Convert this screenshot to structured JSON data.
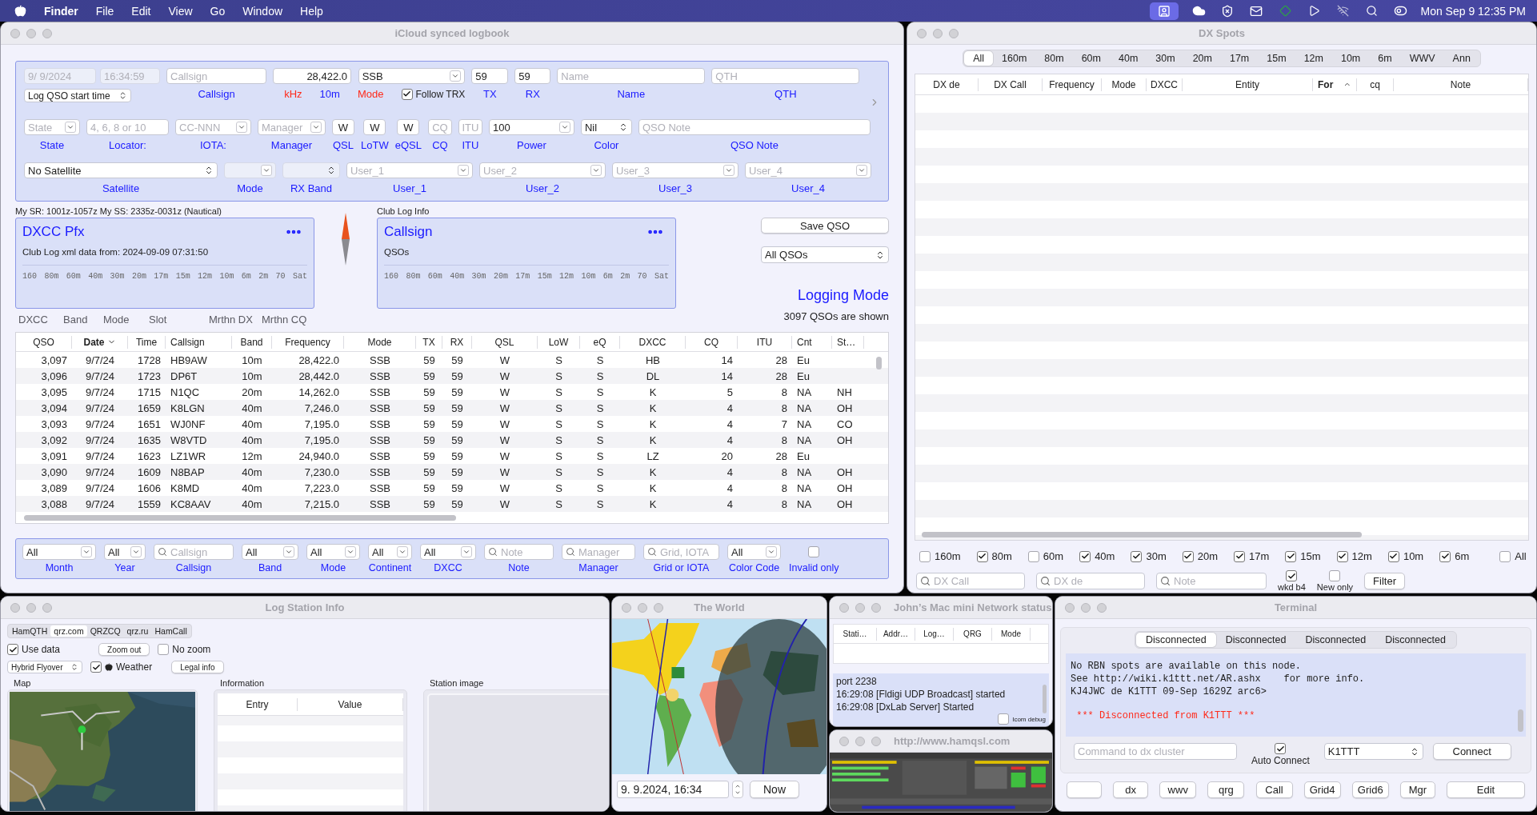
{
  "menu_bar": {
    "app": "Finder",
    "menus": [
      "File",
      "Edit",
      "View",
      "Go",
      "Window",
      "Help"
    ],
    "status_items": [
      {
        "kind": "screen",
        "selected": true
      },
      {
        "kind": "cloud",
        "selected": false
      },
      {
        "kind": "shield",
        "selected": false
      },
      {
        "kind": "mail",
        "selected": false
      },
      {
        "kind": "diamond",
        "selected": false
      },
      {
        "kind": "play",
        "selected": false
      },
      {
        "kind": "wifi",
        "selected": false
      },
      {
        "kind": "search",
        "selected": false
      },
      {
        "kind": "toggle",
        "selected": false
      }
    ],
    "clock": "Mon Sep 9  12:35 PM"
  },
  "logbook": {
    "title": "iCloud synced logbook",
    "form": {
      "start": {
        "date": "9/ 9/2024",
        "time": "16:34:59",
        "disabled": true,
        "time_mode": "Log QSO start time"
      },
      "lines": [
        {
          "fields": [
            {
              "kind": "text",
              "placeholder": "Callsign",
              "labels": [
                {
                  "text": "Callsign",
                  "alert": false
                }
              ]
            },
            {
              "kind": "number",
              "value": "28,422.0",
              "labels": [
                {
                  "text": "kHz",
                  "alert": true
                },
                {
                  "text": "10m",
                  "alert": false
                }
              ]
            },
            {
              "kind": "select",
              "value": "SSB",
              "labels": [
                {
                  "text": "Mode",
                  "alert": true
                }
              ],
              "checkbox": {
                "label": "Follow TRX",
                "checked": true
              }
            },
            {
              "kind": "text",
              "value": "59",
              "labels": [
                {
                  "text": "TX",
                  "alert": false
                }
              ]
            },
            {
              "kind": "text",
              "value": "59",
              "labels": [
                {
                  "text": "RX",
                  "alert": false
                }
              ]
            },
            {
              "kind": "text",
              "placeholder": "Name",
              "labels": [
                {
                  "text": "Name",
                  "alert": false
                }
              ]
            },
            {
              "kind": "text",
              "placeholder": "QTH",
              "labels": [
                {
                  "text": "QTH",
                  "alert": false
                }
              ]
            }
          ]
        },
        {
          "fields": [
            {
              "kind": "select",
              "placeholder": "State",
              "labels": [
                {
                  "text": "State",
                  "alert": false
                }
              ]
            },
            {
              "kind": "text",
              "placeholder": "4, 6, 8 or 10",
              "labels": [
                {
                  "text": "Locator:",
                  "alert": false
                }
              ]
            },
            {
              "kind": "select",
              "placeholder": "CC-NNN",
              "labels": [
                {
                  "text": "IOTA:",
                  "alert": false
                }
              ]
            },
            {
              "kind": "select",
              "placeholder": "Manager",
              "labels": [
                {
                  "text": "Manager",
                  "alert": false
                }
              ]
            },
            {
              "kind": "short",
              "value": "W",
              "labels": [
                {
                  "text": "QSL",
                  "alert": false
                }
              ]
            },
            {
              "kind": "short",
              "value": "W",
              "labels": [
                {
                  "text": "LoTW",
                  "alert": false
                }
              ]
            },
            {
              "kind": "short",
              "value": "W",
              "labels": [
                {
                  "text": "eQSL",
                  "alert": false
                }
              ]
            },
            {
              "kind": "short",
              "placeholder": "CQ",
              "labels": [
                {
                  "text": "CQ",
                  "alert": false
                }
              ]
            },
            {
              "kind": "short",
              "placeholder": "ITU",
              "labels": [
                {
                  "text": "ITU",
                  "alert": false
                }
              ]
            },
            {
              "kind": "select",
              "value": "100",
              "labels": [
                {
                  "text": "Power",
                  "alert": false
                }
              ]
            },
            {
              "kind": "popup",
              "value": "Nil",
              "labels": [
                {
                  "text": "Color",
                  "alert": false
                }
              ]
            },
            {
              "kind": "text",
              "placeholder": "QSO Note",
              "labels": [
                {
                  "text": "QSO Note",
                  "alert": false
                }
              ]
            }
          ]
        },
        {
          "fields": [
            {
              "kind": "popup",
              "value": "No Satellite",
              "disabled": false,
              "labels": [
                {
                  "text": "Satellite",
                  "alert": false
                }
              ]
            },
            {
              "kind": "select",
              "disabled": true,
              "labels": [
                {
                  "text": "Mode",
                  "alert": false
                }
              ]
            },
            {
              "kind": "popup",
              "disabled": true,
              "labels": [
                {
                  "text": "RX Band",
                  "alert": false
                }
              ]
            },
            {
              "kind": "select",
              "placeholder": "User_1",
              "disabled": false,
              "labels": [
                {
                  "text": "User_1",
                  "alert": false
                }
              ]
            },
            {
              "kind": "select",
              "placeholder": "User_2",
              "disabled": false,
              "labels": [
                {
                  "text": "User_2",
                  "alert": false
                }
              ]
            },
            {
              "kind": "select",
              "placeholder": "User_3",
              "disabled": false,
              "labels": [
                {
                  "text": "User_3",
                  "alert": false
                }
              ]
            },
            {
              "kind": "select",
              "placeholder": "User_4",
              "disabled": false,
              "labels": [
                {
                  "text": "User_4",
                  "alert": false
                }
              ]
            }
          ]
        }
      ]
    },
    "sun_times": "My SR: 1001z-1057z  My SS: 2335z-0031z (Nautical)",
    "dxcc_card": {
      "title": "DXCC Pfx",
      "text": "Club Log xml data from: 2024-09-09 07:31:50",
      "bands": [
        "160",
        "80m",
        "60m",
        "40m",
        "30m",
        "20m",
        "17m",
        "15m",
        "12m",
        "10m",
        "6m",
        "2m",
        "70",
        "Sat"
      ]
    },
    "slot_labels": [
      "DXCC",
      "Band",
      "Mode",
      "Slot",
      "Mrthn DX",
      "Mrthn CQ"
    ],
    "club_log": {
      "heading": "Club Log Info",
      "title": "Callsign",
      "text": "QSOs",
      "bands": [
        "160",
        "80m",
        "60m",
        "40m",
        "30m",
        "20m",
        "17m",
        "15m",
        "12m",
        "10m",
        "6m",
        "2m",
        "70",
        "Sat"
      ]
    },
    "save_button": "Save QSO",
    "view_select": "All QSOs",
    "mode_title": "Logging Mode",
    "count": "3097 QSOs are shown",
    "table": {
      "columns": [
        {
          "label": "QSO",
          "sorted": false
        },
        {
          "label": "Date",
          "sorted": true
        },
        {
          "label": "Time",
          "sorted": false
        },
        {
          "label": "Callsign",
          "sorted": false
        },
        {
          "label": "Band",
          "sorted": false
        },
        {
          "label": "Frequency",
          "sorted": false
        },
        {
          "label": "Mode",
          "sorted": false
        },
        {
          "label": "TX",
          "sorted": false
        },
        {
          "label": "RX",
          "sorted": false
        },
        {
          "label": "QSL",
          "sorted": false
        },
        {
          "label": "LoW",
          "sorted": false
        },
        {
          "label": "eQ",
          "sorted": false
        },
        {
          "label": "DXCC",
          "sorted": false
        },
        {
          "label": "CQ",
          "sorted": false
        },
        {
          "label": "ITU",
          "sorted": false
        },
        {
          "label": "Cnt",
          "sorted": false
        },
        {
          "label": "St…",
          "sorted": false
        }
      ],
      "rows": [
        [
          "3,097",
          "9/7/24",
          "1728",
          "HB9AW",
          "10m",
          "28,422.0",
          "SSB",
          "59",
          "59",
          "W",
          "S",
          "S",
          "HB",
          "14",
          "28",
          "Eu"
        ],
        [
          "3,096",
          "9/7/24",
          "1723",
          "DP6T",
          "10m",
          "28,442.0",
          "SSB",
          "59",
          "59",
          "W",
          "S",
          "S",
          "DL",
          "14",
          "28",
          "Eu"
        ],
        [
          "3,095",
          "9/7/24",
          "1715",
          "N1QC",
          "20m",
          "14,262.0",
          "SSB",
          "59",
          "59",
          "W",
          "S",
          "S",
          "K",
          "5",
          "8",
          "NA",
          "NH"
        ],
        [
          "3,094",
          "9/7/24",
          "1659",
          "K8LGN",
          "40m",
          "7,246.0",
          "SSB",
          "59",
          "59",
          "W",
          "S",
          "S",
          "K",
          "4",
          "8",
          "NA",
          "OH"
        ],
        [
          "3,093",
          "9/7/24",
          "1651",
          "WJ0NF",
          "40m",
          "7,195.0",
          "SSB",
          "59",
          "59",
          "W",
          "S",
          "S",
          "K",
          "4",
          "7",
          "NA",
          "CO"
        ],
        [
          "3,092",
          "9/7/24",
          "1635",
          "W8VTD",
          "40m",
          "7,195.0",
          "SSB",
          "59",
          "59",
          "W",
          "S",
          "S",
          "K",
          "4",
          "8",
          "NA",
          "OH"
        ],
        [
          "3,091",
          "9/7/24",
          "1623",
          "LZ1WR",
          "12m",
          "24,940.0",
          "SSB",
          "59",
          "59",
          "W",
          "S",
          "S",
          "LZ",
          "20",
          "28",
          "Eu"
        ],
        [
          "3,090",
          "9/7/24",
          "1609",
          "N8BAP",
          "40m",
          "7,230.0",
          "SSB",
          "59",
          "59",
          "W",
          "S",
          "S",
          "K",
          "4",
          "8",
          "NA",
          "OH"
        ],
        [
          "3,089",
          "9/7/24",
          "1606",
          "K8MD",
          "40m",
          "7,223.0",
          "SSB",
          "59",
          "59",
          "W",
          "S",
          "S",
          "K",
          "4",
          "8",
          "NA",
          "OH"
        ],
        [
          "3,088",
          "9/7/24",
          "1559",
          "KC8AAV",
          "40m",
          "7,215.0",
          "SSB",
          "59",
          "59",
          "W",
          "S",
          "S",
          "K",
          "4",
          "8",
          "NA",
          "OH"
        ]
      ]
    },
    "filters": [
      {
        "kind": "select",
        "value": "All",
        "label": "Month"
      },
      {
        "kind": "select",
        "value": "All",
        "label": "Year"
      },
      {
        "kind": "search",
        "placeholder": "Callsign",
        "label": "Callsign"
      },
      {
        "kind": "select",
        "value": "All",
        "label": "Band"
      },
      {
        "kind": "select",
        "value": "All",
        "label": "Mode"
      },
      {
        "kind": "select",
        "value": "All",
        "label": "Continent"
      },
      {
        "kind": "select",
        "value": "All",
        "label": "DXCC"
      },
      {
        "kind": "search",
        "placeholder": "Note",
        "label": "Note"
      },
      {
        "kind": "search",
        "placeholder": "Manager",
        "label": "Manager"
      },
      {
        "kind": "search",
        "placeholder": "Grid, IOTA",
        "label": "Grid or IOTA"
      },
      {
        "kind": "select",
        "value": "All",
        "label": "Color Code"
      },
      {
        "kind": "checkbox",
        "checked": false,
        "label": "Invalid only"
      }
    ]
  },
  "dx_spots": {
    "title": "DX Spots",
    "tabs": [
      {
        "label": "All",
        "selected": true
      },
      {
        "label": "160m",
        "selected": false
      },
      {
        "label": "80m",
        "selected": false
      },
      {
        "label": "60m",
        "selected": false
      },
      {
        "label": "40m",
        "selected": false
      },
      {
        "label": "30m",
        "selected": false
      },
      {
        "label": "20m",
        "selected": false
      },
      {
        "label": "17m",
        "selected": false
      },
      {
        "label": "15m",
        "selected": false
      },
      {
        "label": "12m",
        "selected": false
      },
      {
        "label": "10m",
        "selected": false
      },
      {
        "label": "6m",
        "selected": false
      },
      {
        "label": "WWV",
        "selected": false
      },
      {
        "label": "Ann",
        "selected": false
      }
    ],
    "columns": [
      {
        "label": "DX de",
        "sorted": false
      },
      {
        "label": "DX Call",
        "sorted": false
      },
      {
        "label": "Frequency",
        "sorted": false
      },
      {
        "label": "Mode",
        "sorted": false
      },
      {
        "label": "DXCC",
        "sorted": false
      },
      {
        "label": "Entity",
        "sorted": false
      },
      {
        "label": "For",
        "sorted": true
      },
      {
        "label": "cq",
        "sorted": false
      },
      {
        "label": "Note",
        "sorted": false
      }
    ],
    "bands": [
      {
        "label": "160m",
        "checked": false
      },
      {
        "label": "80m",
        "checked": true
      },
      {
        "label": "60m",
        "checked": false
      },
      {
        "label": "40m",
        "checked": true
      },
      {
        "label": "30m",
        "checked": true
      },
      {
        "label": "20m",
        "checked": true
      },
      {
        "label": "17m",
        "checked": true
      },
      {
        "label": "15m",
        "checked": true
      },
      {
        "label": "12m",
        "checked": true
      },
      {
        "label": "10m",
        "checked": true
      },
      {
        "label": "6m",
        "checked": true
      },
      {
        "label": "All",
        "checked": false
      }
    ],
    "searches": [
      "DX Call",
      "DX de",
      "Note"
    ],
    "options": [
      {
        "label": "wkd b4",
        "checked": true
      },
      {
        "label": "New only",
        "checked": false
      }
    ],
    "filter_button": "Filter"
  },
  "station_info": {
    "title": "Log Station Info",
    "sources": [
      {
        "label": "HamQTH",
        "selected": false
      },
      {
        "label": "qrz.com",
        "selected": true
      },
      {
        "label": "QRZCQ",
        "selected": false
      },
      {
        "label": "qrz.ru",
        "selected": false
      },
      {
        "label": "HamCall",
        "selected": false
      }
    ],
    "use_data": {
      "label": "Use data",
      "checked": true
    },
    "zoom_button": "Zoom out",
    "no_zoom": {
      "label": "No zoom",
      "checked": false
    },
    "map_type": "Hybrid Flyover",
    "weather": {
      "label": "Weather",
      "checked": true
    },
    "legal_button": "Legal info",
    "map_heading": "Map",
    "info_heading": "Information",
    "info_columns": [
      "Entry",
      "Value"
    ],
    "image_heading": "Station image"
  },
  "world": {
    "title": "The World",
    "date": "9.  9.2024, 16:34",
    "now_button": "Now"
  },
  "network": {
    "title": "John’s Mac mini Network status",
    "columns": [
      "Stati…",
      "Addr…",
      "Log…",
      "QRG",
      "Mode"
    ],
    "log": [
      "port 2238",
      "16:29:08 [Fldigi UDP Broadcast] started",
      "16:29:08 [DxLab Server] Started"
    ],
    "debug": {
      "label": "Icom debug",
      "checked": false
    }
  },
  "hamqsl": {
    "title": "http://www.hamqsl.com"
  },
  "terminal": {
    "title": "Terminal",
    "tabs": [
      {
        "label": "Disconnected",
        "selected": true
      },
      {
        "label": "Disconnected",
        "selected": false
      },
      {
        "label": "Disconnected",
        "selected": false
      },
      {
        "label": "Disconnected",
        "selected": false
      }
    ],
    "lines": [
      {
        "kind": "info",
        "text": "No RBN spots are available on this node."
      },
      {
        "kind": "info",
        "text": "See http://wiki.k1ttt.net/AR.ashx    for more info."
      },
      {
        "kind": "info",
        "text": "KJ4JWC de K1TTT 09-Sep 1629Z arc6>"
      },
      {
        "kind": "alert",
        "text": " *** Disconnected from K1TTT ***"
      }
    ],
    "command_placeholder": "Command to dx cluster",
    "auto_connect": {
      "label": "Auto Connect",
      "checked": true
    },
    "node": "K1TTT",
    "connect_button": "Connect",
    "buttons": [
      {
        "kind": "blank"
      },
      {
        "kind": "command",
        "label": "dx"
      },
      {
        "kind": "command",
        "label": "wwv"
      },
      {
        "kind": "command",
        "label": "qrg"
      },
      {
        "kind": "command",
        "label": "Call"
      },
      {
        "kind": "command",
        "label": "Grid4"
      },
      {
        "kind": "command",
        "label": "Grid6"
      },
      {
        "kind": "command",
        "label": "Mgr"
      },
      {
        "kind": "command",
        "label": "Edit"
      }
    ]
  }
}
